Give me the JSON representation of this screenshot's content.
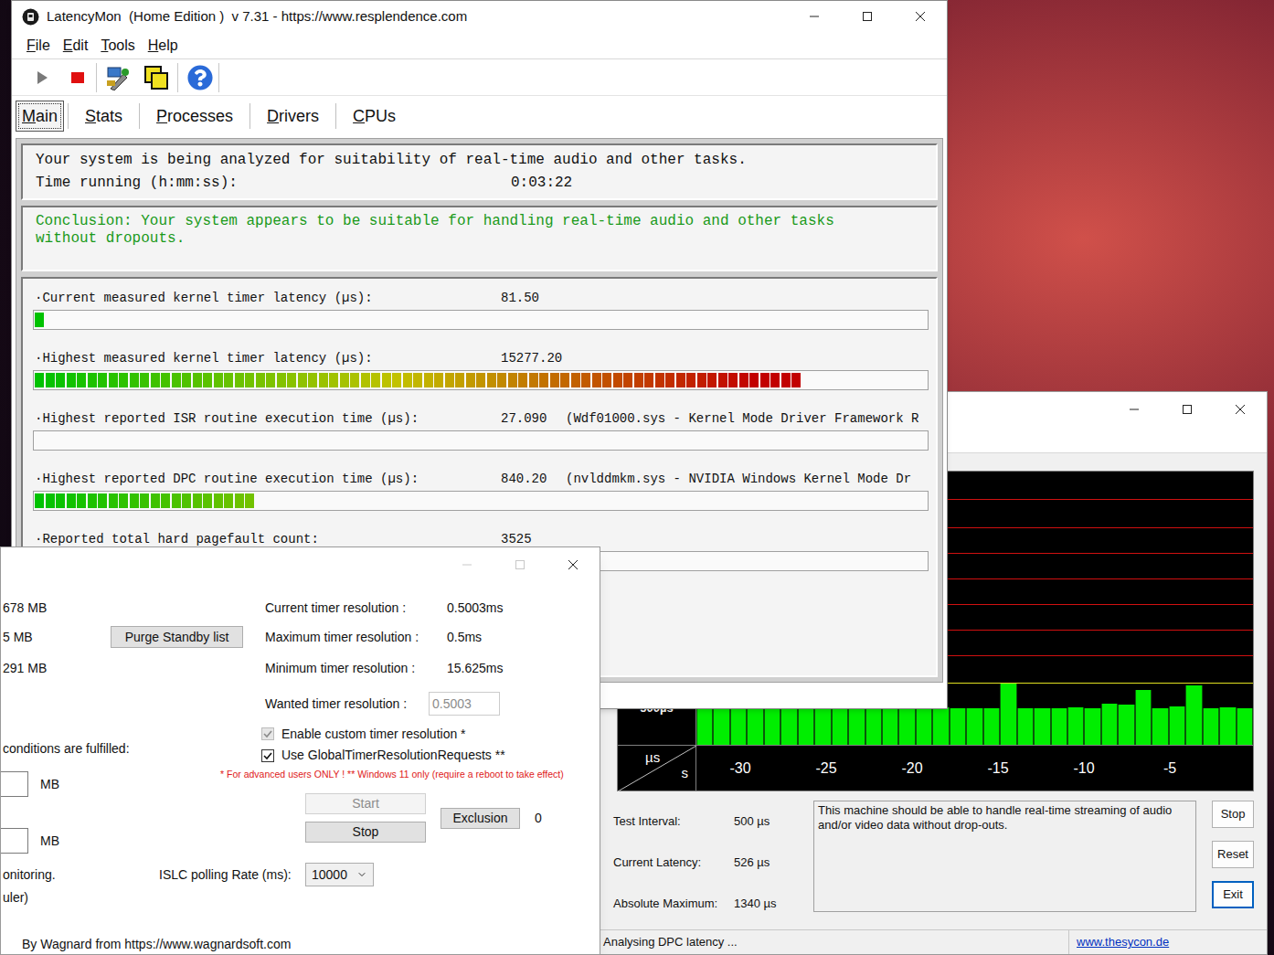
{
  "latencymon": {
    "title": "LatencyMon  (Home Edition )  v 7.31 - https://www.resplendence.com",
    "menu": [
      "File",
      "Edit",
      "Tools",
      "Help"
    ],
    "tabs": [
      {
        "label": "Main",
        "selected": true
      },
      {
        "label": "Stats",
        "selected": false
      },
      {
        "label": "Processes",
        "selected": false
      },
      {
        "label": "Drivers",
        "selected": false
      },
      {
        "label": "CPUs",
        "selected": false
      }
    ],
    "analysis": {
      "text": "Your system is being analyzed for suitability of real-time audio and other tasks.",
      "time_label": "Time running (h:mm:ss):",
      "time": "0:03:22"
    },
    "conclusion": [
      "Conclusion: Your system appears to be suitable for handling real-time audio and other tasks",
      "without dropouts."
    ],
    "metrics": [
      {
        "label": "·Current measured kernel timer latency (µs):",
        "value": "81.50",
        "detail": "",
        "level": 0.014
      },
      {
        "label": "·Highest measured kernel timer latency (µs):",
        "value": "15277.20",
        "detail": "",
        "level": 0.86
      },
      {
        "label": "·Highest reported ISR routine execution time (µs):",
        "value": "27.090",
        "detail": "(Wdf01000.sys - Kernel Mode Driver Framework R",
        "level": 0
      },
      {
        "label": "·Highest reported DPC routine execution time (µs):",
        "value": "840.20",
        "detail": "(nvlddmkm.sys - NVIDIA Windows Kernel Mode Dr",
        "level": 0.243
      },
      {
        "label": "·Reported total hard pagefault count:",
        "value": "3525",
        "detail": "",
        "level": 0
      }
    ]
  },
  "islc": {
    "memory": [
      "678 MB",
      "5 MB",
      "291 MB"
    ],
    "purge_button": "Purge Standby list",
    "timer": [
      {
        "label": "Current timer resolution :",
        "value": "0.5003ms"
      },
      {
        "label": "Maximum timer resolution :",
        "value": "0.5ms"
      },
      {
        "label": "Minimum timer resolution :",
        "value": "15.625ms"
      }
    ],
    "wanted": {
      "label": "Wanted timer resolution :",
      "value": "0.5003",
      "disabled": true
    },
    "options": [
      {
        "label": "Enable custom timer resolution *",
        "checked": true,
        "disabled": true
      },
      {
        "label": "Use GlobalTimerResolutionRequests **",
        "checked": true,
        "disabled": false
      }
    ],
    "conditions_label": "conditions are fulfilled:",
    "fields": [
      {
        "value": "",
        "unit": "MB"
      },
      {
        "value": "",
        "unit": "MB"
      }
    ],
    "warning": "* For advanced users ONLY !  ** Windows 11 only (require a reboot to take effect)",
    "buttons": [
      {
        "label": "Start",
        "disabled": true
      },
      {
        "label": "Stop",
        "disabled": false
      }
    ],
    "exclusion": {
      "label": "Exclusion",
      "count": "0"
    },
    "notes": [
      "onitoring.",
      "uler)"
    ],
    "polling": {
      "label": "ISLC polling Rate (ms):",
      "value": "10000"
    },
    "credit": "By Wagnard from https://www.wagnardsoft.com"
  },
  "dpc": {
    "chart": {
      "y_tick": "500µs",
      "y_unit": "µs",
      "x_unit": "s",
      "x_ticks": [
        "-30",
        "-25",
        "-20",
        "-15",
        "-10",
        "-5"
      ],
      "bars_us": [
        505,
        510,
        500,
        505,
        500,
        510,
        505,
        500,
        505,
        510,
        500,
        505,
        500,
        505,
        510,
        500,
        505,
        500,
        840,
        505,
        500,
        505,
        510,
        505,
        560,
        550,
        750,
        505,
        525,
        810,
        505,
        510,
        505
      ]
    },
    "stats": [
      {
        "label": "Test Interval:",
        "value": "500 µs"
      },
      {
        "label": "Current Latency:",
        "value": "526 µs"
      },
      {
        "label": "Absolute Maximum:",
        "value": "1340 µs"
      }
    ],
    "message": "This machine should be able to handle real-time streaming of audio and/or video data without drop-outs.",
    "buttons": [
      {
        "label": "Stop",
        "focused": false
      },
      {
        "label": "Reset",
        "focused": false
      },
      {
        "label": "Exit",
        "focused": true
      }
    ],
    "status": "Analysing DPC latency ...",
    "link": "www.thesycon.de"
  }
}
